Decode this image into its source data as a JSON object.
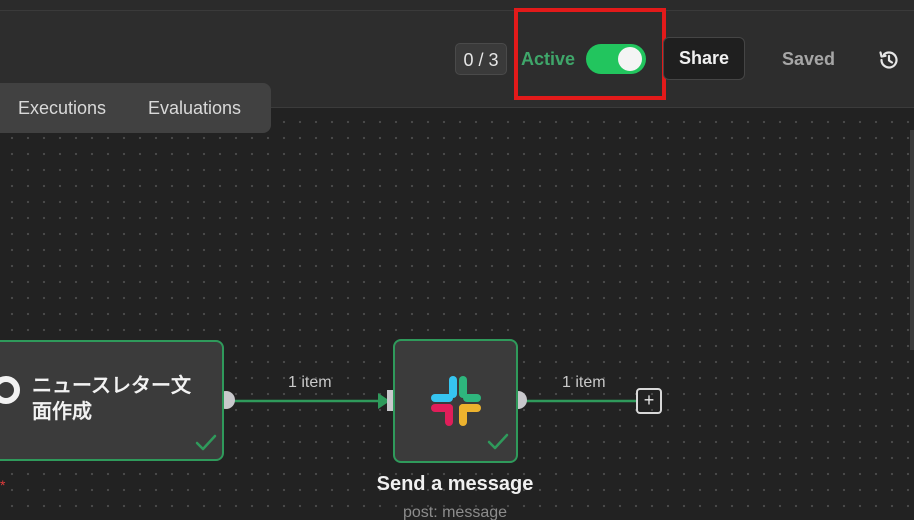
{
  "header": {
    "counter": "0 / 3",
    "active_label": "Active",
    "active_state": true,
    "share_label": "Share",
    "saved_label": "Saved",
    "history_icon": "history-icon"
  },
  "tabs": [
    {
      "label": "Executions"
    },
    {
      "label": "Evaluations"
    }
  ],
  "nodes": [
    {
      "title": "ニュースレター文面作成",
      "status": "success",
      "status_icon": "check-icon"
    },
    {
      "title": "Send a message",
      "subtitle": "post: message",
      "icon": "slack-icon",
      "status": "success",
      "status_icon": "check-icon"
    }
  ],
  "connections": [
    {
      "label": "1 item"
    },
    {
      "label": "1 item"
    }
  ],
  "misc": {
    "required_marker": "*"
  },
  "colors": {
    "accent_green": "#22c55e",
    "node_border": "#2f9a5b",
    "active_text": "#3fa66a",
    "highlight": "#e21a1a"
  }
}
